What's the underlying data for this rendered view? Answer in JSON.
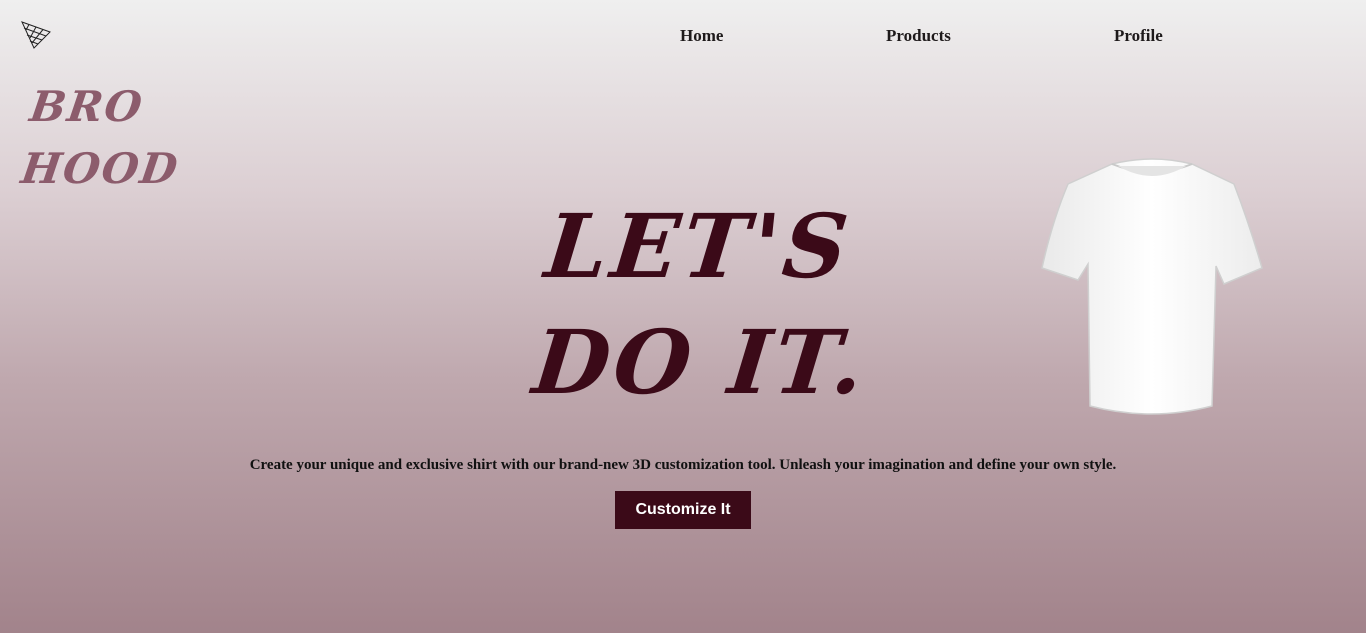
{
  "nav": {
    "home": "Home",
    "products": "Products",
    "profile": "Profile"
  },
  "brand": {
    "line1": "BRO",
    "line2": "HOOD",
    "color": "#8c5c6c"
  },
  "hero": {
    "line1": "LET'S",
    "line2": "DO IT.",
    "color": "#3b0a18"
  },
  "tagline": "Create your unique and exclusive shirt with our brand-new 3D customization tool. Unleash your imagination and define your own style.",
  "cta": {
    "label": "Customize It",
    "color": "#3b0a18"
  },
  "images": {
    "logo": "triangle-mesh-logo-icon",
    "product": "white-tshirt"
  }
}
